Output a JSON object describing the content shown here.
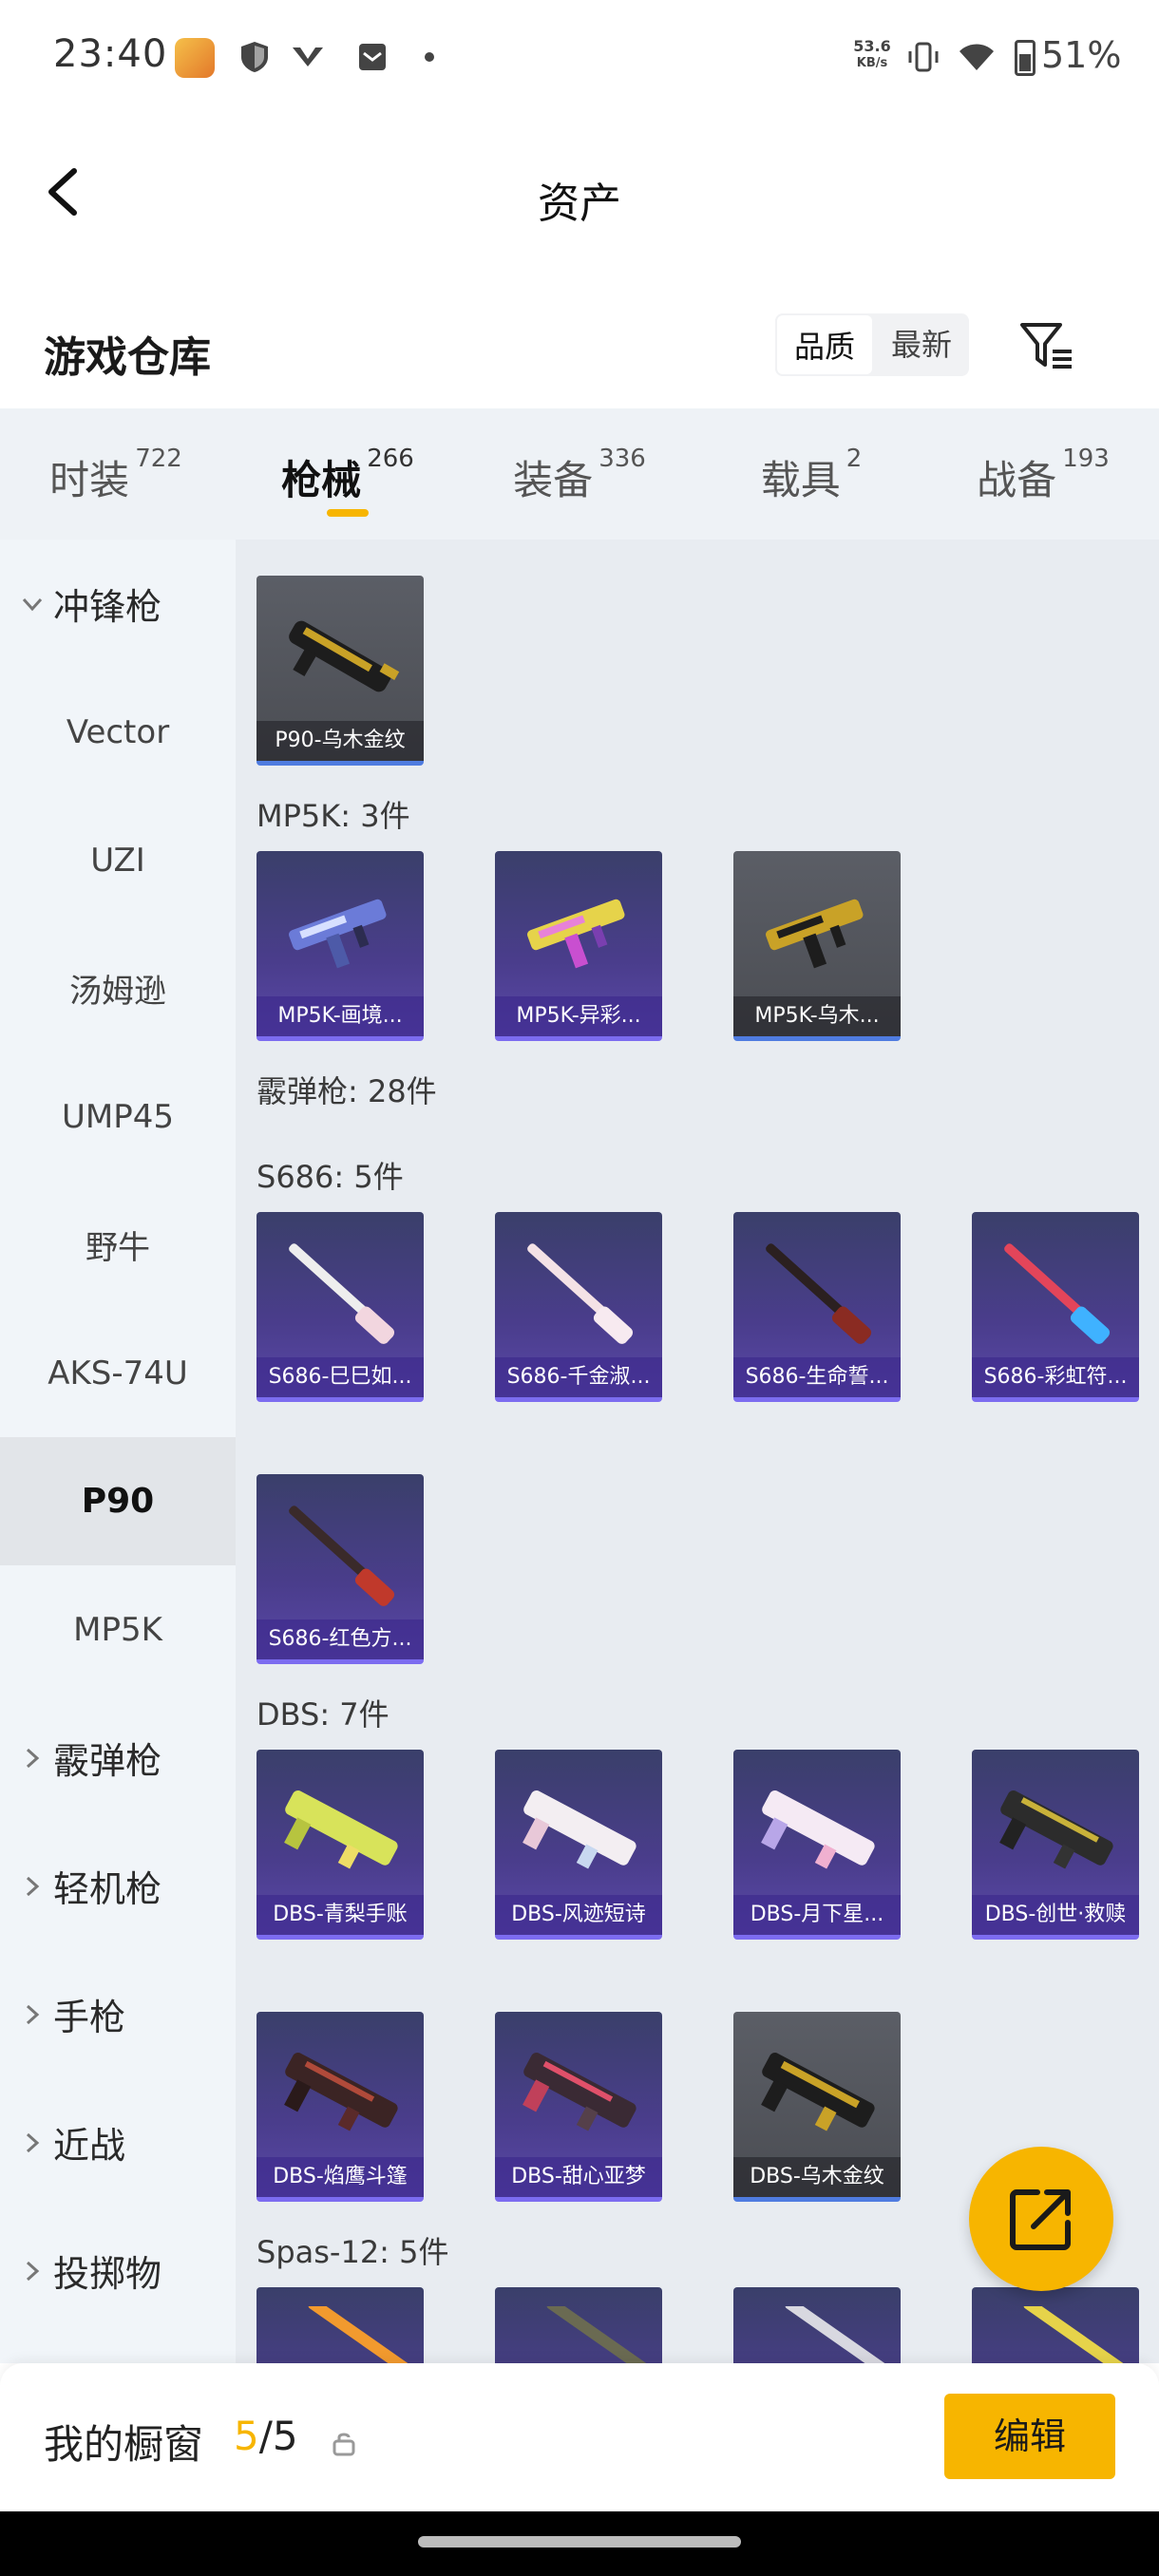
{
  "status_bar": {
    "time": "23:40",
    "net_speed_value": "53.6",
    "net_speed_unit": "KB/s",
    "battery": "51%",
    "icons": [
      "app-icon",
      "shield-icon",
      "vpn-icon",
      "mail-icon",
      "dot-icon",
      "vibrate-icon",
      "wifi-icon",
      "battery-icon"
    ]
  },
  "header": {
    "title": "资产",
    "back_icon": "chevron-left-icon"
  },
  "warehouse": {
    "title": "游戏仓库",
    "sort_options": [
      "品质",
      "最新"
    ],
    "sort_selected": "品质",
    "filter_icon": "filter-icon"
  },
  "tabs": [
    {
      "label": "时装",
      "count": "722"
    },
    {
      "label": "枪械",
      "count": "266",
      "active": true
    },
    {
      "label": "装备",
      "count": "336"
    },
    {
      "label": "载具",
      "count": "2"
    },
    {
      "label": "战备",
      "count": "193"
    }
  ],
  "sidebar": {
    "items": [
      {
        "label": "冲锋枪",
        "type": "group",
        "expanded": true
      },
      {
        "label": "Vector"
      },
      {
        "label": "UZI"
      },
      {
        "label": "汤姆逊"
      },
      {
        "label": "UMP45"
      },
      {
        "label": "野牛"
      },
      {
        "label": "AKS-74U"
      },
      {
        "label": "P90",
        "active": true
      },
      {
        "label": "MP5K"
      },
      {
        "label": "霰弹枪",
        "type": "group"
      },
      {
        "label": "轻机枪",
        "type": "group"
      },
      {
        "label": "手枪",
        "type": "group"
      },
      {
        "label": "近战",
        "type": "group"
      },
      {
        "label": "投掷物",
        "type": "group"
      }
    ]
  },
  "content": {
    "p90_items": [
      "P90-乌木金纹"
    ],
    "mp5k_label": "MP5K: 3件",
    "mp5k_items": [
      "MP5K-画境...",
      "MP5K-异彩...",
      "MP5K-乌木..."
    ],
    "shotgun_label": "霰弹枪: 28件",
    "s686_label": "S686: 5件",
    "s686_items": [
      "S686-巳巳如...",
      "S686-千金淑...",
      "S686-生命誓...",
      "S686-彩虹符...",
      "S686-红色方..."
    ],
    "dbs_label": "DBS: 7件",
    "dbs_items": [
      "DBS-青梨手账",
      "DBS-风迹短诗",
      "DBS-月下星...",
      "DBS-创世·救赎",
      "DBS-焰鹰斗篷",
      "DBS-甜心亚梦",
      "DBS-乌木金纹"
    ],
    "spas_label": "Spas-12: 5件"
  },
  "fab": {
    "icon": "share-export-icon"
  },
  "bottom_bar": {
    "label": "我的橱窗",
    "current": "5",
    "slash_total": "/5",
    "lock_icon": "lock-icon",
    "edit_label": "编辑"
  },
  "colors": {
    "accent": "#f7b500",
    "card_purple": "#4a3d8c",
    "card_gray": "#55585f"
  }
}
